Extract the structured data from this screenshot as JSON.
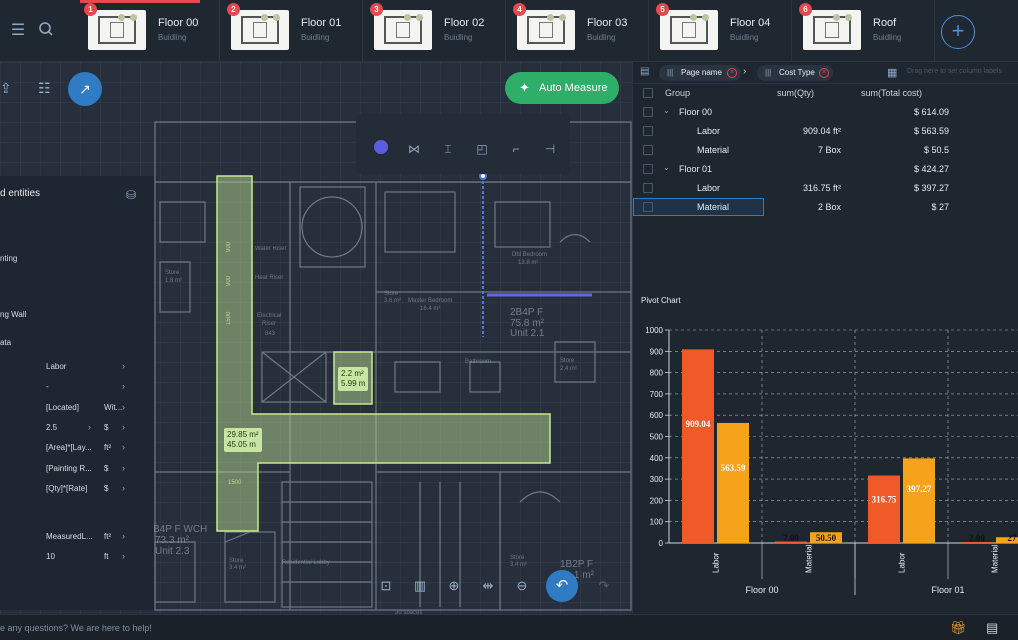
{
  "floors": [
    {
      "badge": "1",
      "name": "Floor 00",
      "sub": "Buidling",
      "active": true
    },
    {
      "badge": "2",
      "name": "Floor 01",
      "sub": "Buidling",
      "active": false
    },
    {
      "badge": "3",
      "name": "Floor 02",
      "sub": "Buidling",
      "active": false
    },
    {
      "badge": "4",
      "name": "Floor 03",
      "sub": "Buidling",
      "active": false
    },
    {
      "badge": "5",
      "name": "Floor 04",
      "sub": "Buidling",
      "active": false
    },
    {
      "badge": "6",
      "name": "Roof",
      "sub": "Buidling",
      "active": false
    }
  ],
  "toolbar": {
    "menu_icon": "hamburger-icon",
    "search_icon": "search-icon",
    "add_icon": "plus-icon",
    "add_glyph": "+"
  },
  "canvas": {
    "auto_measure_label": "Auto Measure",
    "area_labels": [
      {
        "area": "2.2 m²",
        "perimeter": "5.99 m"
      },
      {
        "area": "29.85 m²",
        "perimeter": "45.05 m"
      }
    ]
  },
  "left_panel": {
    "header": "d entities",
    "rows": [
      {
        "label": "nting"
      },
      {
        "label": "ng Wall"
      },
      {
        "label": "ata"
      }
    ],
    "fields": [
      {
        "value": "Labor",
        "unit": ""
      },
      {
        "value": "-",
        "unit": ""
      },
      {
        "value": "[Located]",
        "extra": "Wit...",
        "unit": ""
      },
      {
        "value": "2.5",
        "unit": "$"
      },
      {
        "value": "[Area]*[Lay...",
        "unit": "ft²"
      },
      {
        "value": "[Painting R...",
        "unit": "$"
      },
      {
        "value": "[Qty]*[Rate]",
        "unit": "$"
      },
      {
        "value": "MeasuredL...",
        "unit": "ft²"
      },
      {
        "value": "10",
        "unit": "ft"
      }
    ]
  },
  "pivot": {
    "pills": [
      {
        "label": "Page name"
      },
      {
        "label": "Cost Type"
      }
    ],
    "drag_hint": "Drag here to set column labels",
    "headers": [
      "Group",
      "sum(Qty)",
      "sum(Total cost)"
    ],
    "rows": [
      {
        "level": 0,
        "label": "Floor 00",
        "qty": "",
        "cost": "$ 614.09"
      },
      {
        "level": 1,
        "label": "Labor",
        "qty": "909.04 ft²",
        "cost": "$ 563.59"
      },
      {
        "level": 1,
        "label": "Material",
        "qty": "7 Box",
        "cost": "$ 50.5"
      },
      {
        "level": 0,
        "label": "Floor 01",
        "qty": "",
        "cost": "$ 424.27"
      },
      {
        "level": 1,
        "label": "Labor",
        "qty": "316.75 ft²",
        "cost": "$ 397.27"
      },
      {
        "level": 1,
        "label": "Material",
        "qty": "2 Box",
        "cost": "$ 27",
        "selected": true
      }
    ]
  },
  "chart_title": "Pivot Chart",
  "chart_data": {
    "type": "bar",
    "groups": [
      "Floor 00",
      "Floor 01"
    ],
    "categories": [
      "Labor",
      "Material"
    ],
    "series": [
      {
        "values": [
          909.04,
          7.0,
          316.75,
          2.0
        ],
        "labels": [
          "909.04",
          "7.00",
          "316.75",
          "2.00"
        ],
        "color": "#f05a28"
      },
      {
        "values": [
          563.59,
          50.5,
          397.27,
          27
        ],
        "labels": [
          "563.59",
          "50.50",
          "397.27",
          "27"
        ],
        "color": "#f7a21b"
      }
    ],
    "yticks": [
      "0",
      "100",
      "200",
      "300",
      "400",
      "500",
      "600",
      "700",
      "800",
      "900",
      "1000"
    ],
    "ylim": [
      0,
      1000
    ],
    "grid": true
  },
  "footer": {
    "help_text": "e any questions? We are here to help!"
  },
  "colors": {
    "accent": "#2f7bc4",
    "green": "#2fae6a",
    "danger": "#e5484d"
  }
}
